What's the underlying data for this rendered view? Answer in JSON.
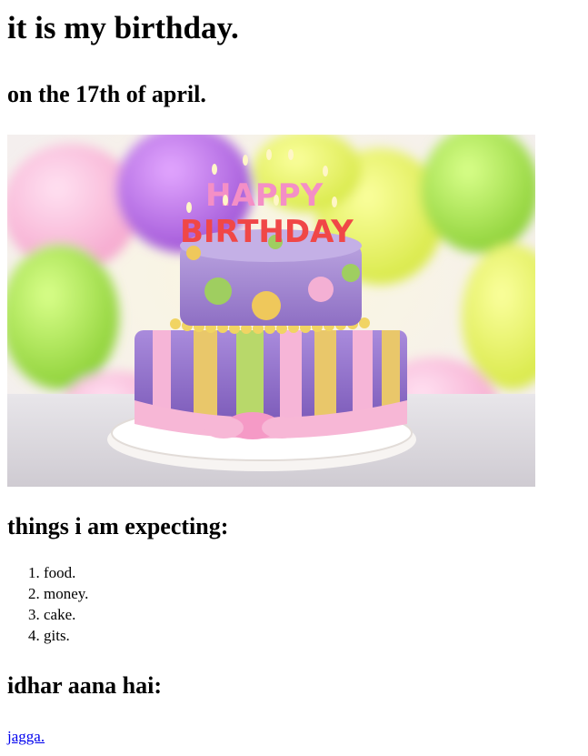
{
  "title": "it is my birthday.",
  "subtitle": "on the 17th of april.",
  "image": {
    "alt": "Happy Birthday cake",
    "candle_text_line1": "HAPPY",
    "candle_text_line2": "BIRTHDAY"
  },
  "expecting": {
    "heading": "things i am expecting:",
    "items": [
      "food.",
      "money.",
      "cake.",
      "gits."
    ]
  },
  "destination": {
    "heading": "idhar aana hai:",
    "link_text": "jagga."
  },
  "colors": {
    "link": "#0000ee",
    "text": "#000000",
    "background": "#ffffff"
  }
}
